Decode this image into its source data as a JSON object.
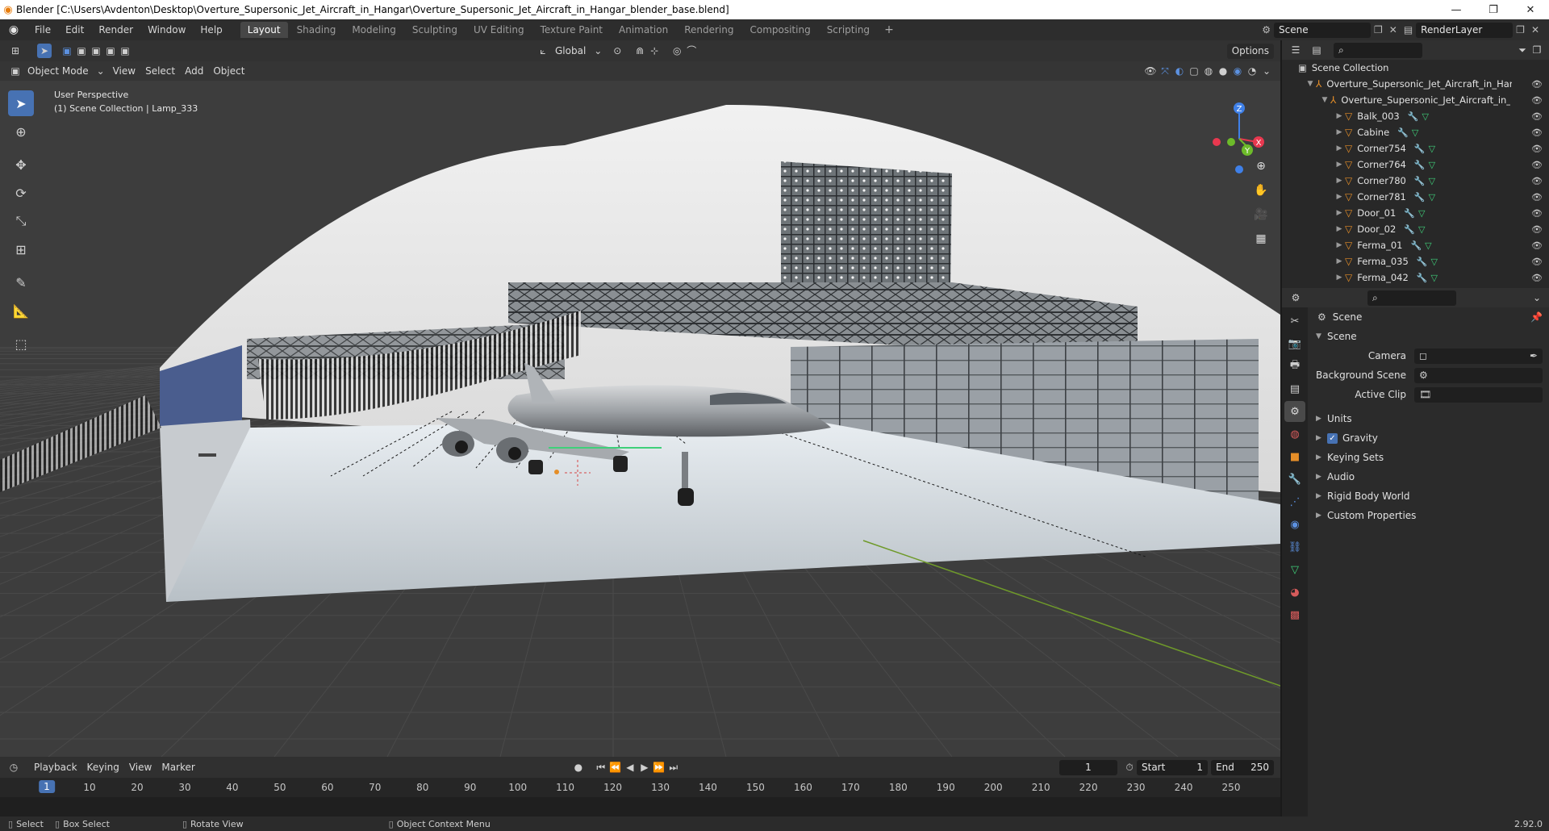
{
  "titlebar": {
    "title": "Blender [C:\\Users\\Avdenton\\Desktop\\Overture_Supersonic_Jet_Aircraft_in_Hangar\\Overture_Supersonic_Jet_Aircraft_in_Hangar_blender_base.blend]"
  },
  "menu": {
    "items": [
      "File",
      "Edit",
      "Render",
      "Window",
      "Help"
    ]
  },
  "workspaces": {
    "tabs": [
      "Layout",
      "Shading",
      "Modeling",
      "Sculpting",
      "UV Editing",
      "Texture Paint",
      "Animation",
      "Rendering",
      "Compositing",
      "Scripting"
    ],
    "active": "Layout"
  },
  "top_right": {
    "scene": "Scene",
    "view_layer": "RenderLayer"
  },
  "viewport": {
    "transform_orientation": "Global",
    "options_label": "Options",
    "mode": "Object Mode",
    "menus": [
      "View",
      "Select",
      "Add",
      "Object"
    ],
    "view_name": "User Perspective",
    "context": "(1) Scene Collection | Lamp_333"
  },
  "outliner": {
    "root": "Scene Collection",
    "collection": "Overture_Supersonic_Jet_Aircraft_in_Hangar",
    "subcollection": "Overture_Supersonic_Jet_Aircraft_in_Har",
    "objects": [
      "Balk_003",
      "Cabine",
      "Corner754",
      "Corner764",
      "Corner780",
      "Corner781",
      "Door_01",
      "Door_02",
      "Ferma_01",
      "Ferma_035",
      "Ferma_042"
    ]
  },
  "properties": {
    "header": "Scene",
    "section": "Scene",
    "fields": [
      {
        "label": "Camera",
        "value": ""
      },
      {
        "label": "Background Scene",
        "value": ""
      },
      {
        "label": "Active Clip",
        "value": ""
      }
    ],
    "subsections": [
      "Units",
      "Gravity",
      "Keying Sets",
      "Audio",
      "Rigid Body World",
      "Custom Properties"
    ],
    "gravity_checked": true
  },
  "timeline": {
    "menus": [
      "Playback",
      "Keying",
      "View",
      "Marker"
    ],
    "current_frame": "1",
    "start_label": "Start",
    "start": "1",
    "end_label": "End",
    "end": "250",
    "ticks": [
      "1",
      "10",
      "20",
      "30",
      "40",
      "50",
      "60",
      "70",
      "80",
      "90",
      "100",
      "110",
      "120",
      "130",
      "140",
      "150",
      "160",
      "170",
      "180",
      "190",
      "200",
      "210",
      "220",
      "230",
      "240",
      "250"
    ]
  },
  "statusbar": {
    "select": "Select",
    "box_select": "Box Select",
    "rotate": "Rotate View",
    "context_menu": "Object Context Menu",
    "version": "2.92.0"
  },
  "colors": {
    "accent": "#4772b3",
    "object_icon": "#e58e28",
    "modifier_icon": "#5c91e0",
    "mesh_icon": "#3fcf7a",
    "axis_x": "#e8384f",
    "axis_y": "#6dbb2a",
    "axis_z": "#3f80e8"
  }
}
